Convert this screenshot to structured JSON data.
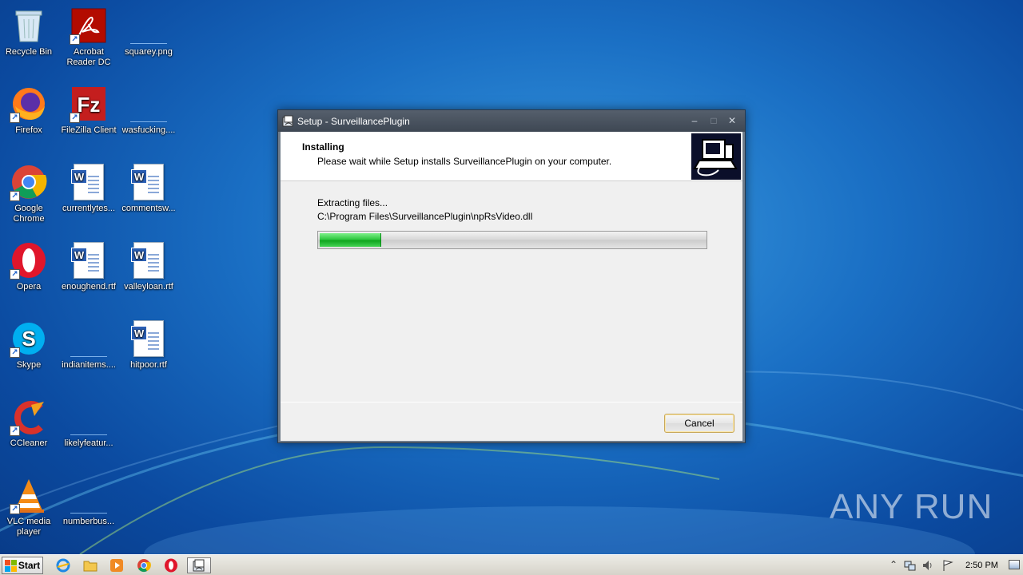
{
  "desktop": {
    "icons": [
      {
        "label": "Recycle Bin",
        "icon": "recycle-bin-icon"
      },
      {
        "label": "Acrobat Reader DC",
        "icon": "acrobat-icon"
      },
      {
        "label": "squarey.png",
        "icon": "image-file-icon"
      },
      {
        "label": "Firefox",
        "icon": "firefox-icon"
      },
      {
        "label": "FileZilla Client",
        "icon": "filezilla-icon"
      },
      {
        "label": "wasfucking....",
        "icon": "file-icon"
      },
      {
        "label": "Google Chrome",
        "icon": "chrome-icon"
      },
      {
        "label": "currentlytes...",
        "icon": "word-doc-icon"
      },
      {
        "label": "commentsw...",
        "icon": "word-doc-icon"
      },
      {
        "label": "Opera",
        "icon": "opera-icon"
      },
      {
        "label": "enoughend.rtf",
        "icon": "word-doc-icon"
      },
      {
        "label": "valleyloan.rtf",
        "icon": "word-doc-icon"
      },
      {
        "label": "Skype",
        "icon": "skype-icon"
      },
      {
        "label": "indianitems....",
        "icon": "file-icon"
      },
      {
        "label": "hitpoor.rtf",
        "icon": "word-doc-icon"
      },
      {
        "label": "CCleaner",
        "icon": "ccleaner-icon"
      },
      {
        "label": "likelyfeatur...",
        "icon": "file-icon"
      },
      {
        "label": "VLC media player",
        "icon": "vlc-icon"
      },
      {
        "label": "numberbus...",
        "icon": "file-icon"
      }
    ]
  },
  "window": {
    "title": "Setup - SurveillancePlugin",
    "header_title": "Installing",
    "header_subtitle": "Please wait while Setup installs SurveillancePlugin on your computer.",
    "status_text": "Extracting files...",
    "file_path": "C:\\Program Files\\SurveillancePlugin\\npRsVideo.dll",
    "progress_fraction": 0.16,
    "cancel_label": "Cancel",
    "controls": {
      "minimize": "–",
      "maximize": "□",
      "close": "✕"
    }
  },
  "taskbar": {
    "start_label": "Start",
    "clock": "2:50 PM",
    "pinned": [
      "ie-icon",
      "explorer-icon",
      "media-player-icon",
      "chrome-icon",
      "opera-icon",
      "setup-icon"
    ]
  },
  "watermark": "ANY RUN",
  "colors": {
    "progress_green": "#2fc840",
    "titlebar": "#3e4753",
    "desktop_blue": "#1a6fc4"
  }
}
